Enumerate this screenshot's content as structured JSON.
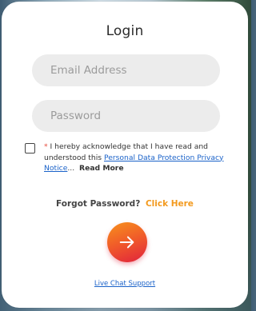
{
  "title": "Login",
  "email": {
    "placeholder": "Email Address",
    "value": ""
  },
  "password": {
    "placeholder": "Password",
    "value": ""
  },
  "consent": {
    "checked": false,
    "required_mark": "*",
    "text": "I hereby acknowledge that I have read and understood this",
    "link_label": "Personal Data Protection Privacy Notice",
    "ellipsis": "...",
    "read_more": "Read More"
  },
  "forgot": {
    "prompt": "Forgot Password?",
    "link": "Click Here"
  },
  "submit": {
    "icon": "arrow-right-icon"
  },
  "support": {
    "label": "Live Chat Support"
  },
  "colors": {
    "accent_orange": "#f39a1e",
    "button_gradient_start": "#f7921c",
    "button_gradient_end": "#e0223d",
    "link_blue": "#1a62c9",
    "field_bg": "#ececec"
  }
}
